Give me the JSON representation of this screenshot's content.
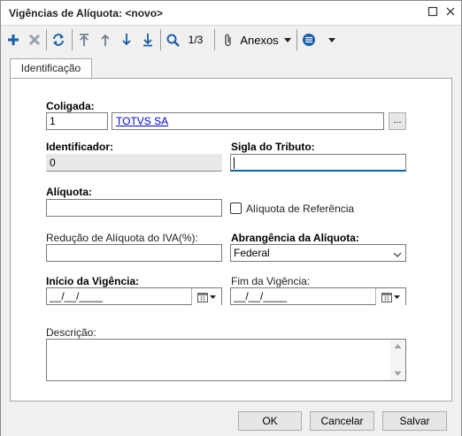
{
  "window": {
    "title": "Vigências de Alíquota: <novo>"
  },
  "toolbar": {
    "record_position": "1/3",
    "attachments_label": "Anexos"
  },
  "tabs": [
    {
      "label": "Identificação"
    }
  ],
  "form": {
    "coligada": {
      "label": "Coligada:",
      "value": "1",
      "name_link": "TOTVS SA",
      "lookup_label": "..."
    },
    "identificador": {
      "label": "Identificador:",
      "value": "0"
    },
    "sigla_tributo": {
      "label": "Sigla do Tributo:",
      "value": ""
    },
    "aliquota": {
      "label": "Alíquota:",
      "value": ""
    },
    "aliquota_referencia": {
      "label": "Alíquota de Referência",
      "checked": false
    },
    "reducao_iva": {
      "label": "Redução de Alíquota do IVA(%):",
      "value": ""
    },
    "abrangencia": {
      "label": "Abrangência da Alíquota:",
      "value": "Federal"
    },
    "inicio_vigencia": {
      "label": "Início da Vigência:",
      "value": "__/__/____"
    },
    "fim_vigencia": {
      "label": "Fim da Vigência:",
      "value": "__/__/____"
    },
    "descricao": {
      "label": "Descrição:",
      "value": ""
    }
  },
  "footer": {
    "ok_label": "OK",
    "cancel_label": "Cancelar",
    "save_label": "Salvar"
  },
  "colors": {
    "accent": "#0a64b4",
    "link": "#0000c8",
    "toolbar_icon": "#1b5ea8"
  }
}
